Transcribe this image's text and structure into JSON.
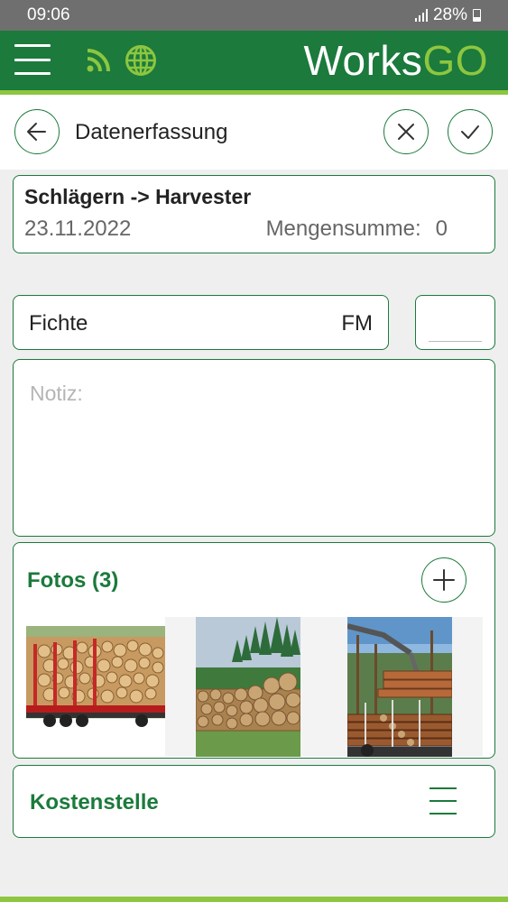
{
  "status_bar": {
    "time": "09:06",
    "battery": "28%"
  },
  "app_bar": {
    "logo_part1": "Works",
    "logo_part2": "GO",
    "colors": {
      "primary": "#1b7a3c",
      "accent": "#8dc63f"
    }
  },
  "toolbar": {
    "title": "Datenerfassung"
  },
  "header": {
    "title": "Schlägern -> Harvester",
    "date": "23.11.2022",
    "sum_label": "Mengensumme:",
    "sum_value": "0"
  },
  "species": {
    "name": "Fichte",
    "unit": "FM",
    "quantity": ""
  },
  "note": {
    "placeholder": "Notiz:"
  },
  "photos": {
    "title": "Fotos (3)",
    "items": [
      {
        "name": "photo-log-truck"
      },
      {
        "name": "photo-log-pile"
      },
      {
        "name": "photo-harvester"
      }
    ]
  },
  "cost_center": {
    "title": "Kostenstelle"
  }
}
